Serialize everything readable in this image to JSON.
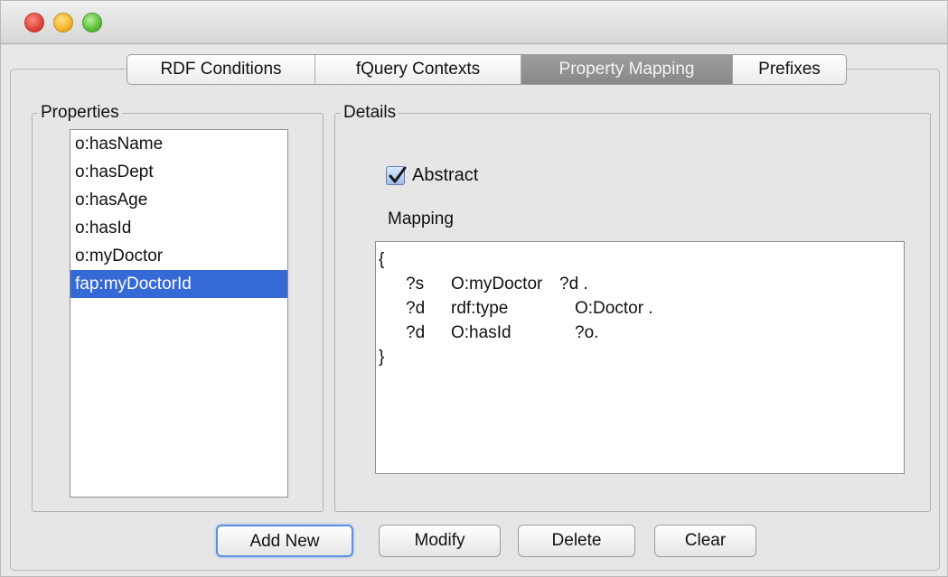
{
  "tabs": {
    "rdf_conditions": "RDF Conditions",
    "fquery_contexts": "fQuery Contexts",
    "property_mapping": "Property Mapping",
    "prefixes": "Prefixes"
  },
  "properties": {
    "title": "Properties",
    "items": [
      "o:hasName",
      "o:hasDept",
      "o:hasAge",
      "o:hasId",
      "o:myDoctor",
      "fap:myDoctorId"
    ],
    "selected_index": 5
  },
  "details": {
    "title": "Details",
    "abstract_label": "Abstract",
    "abstract_checked": true,
    "mapping_label": "Mapping",
    "mapping_lines": [
      [
        "{",
        "",
        ""
      ],
      [
        "?s",
        "O:myDoctor",
        "?d ."
      ],
      [
        "?d",
        "rdf:type",
        "O:Doctor ."
      ],
      [
        "?d",
        "O:hasId",
        "?o."
      ],
      [
        "}",
        "",
        ""
      ]
    ]
  },
  "buttons": {
    "add_new": "Add New",
    "modify": "Modify",
    "delete": "Delete",
    "clear": "Clear"
  },
  "colors": {
    "selection": "#3569d6",
    "active_tab": "#8f8f8f"
  }
}
